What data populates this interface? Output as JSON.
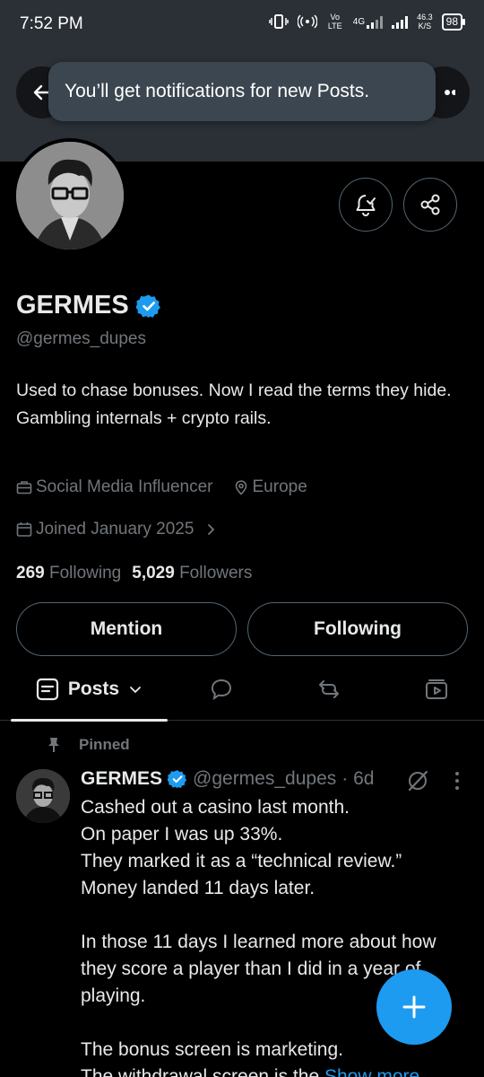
{
  "status_bar": {
    "time": "7:52 PM",
    "vo_lte": "Vo LTE",
    "network": "4G",
    "net_speed_value": "46.3",
    "net_speed_unit": "K/S",
    "battery": "98",
    "icons": [
      "vibrate-icon",
      "hotspot-icon",
      "signal-icon",
      "battery-icon"
    ]
  },
  "toast": {
    "text": "You’ll get notifications for new Posts."
  },
  "profile": {
    "name": "GERMES",
    "handle": "@germes_dupes",
    "bio_line1": "Used to chase bonuses. Now I read the terms they hide.",
    "bio_line2": "Gambling internals + crypto rails.",
    "category": "Social Media Influencer",
    "location": "Europe",
    "joined": "Joined January 2025",
    "following_count": "269",
    "following_label": "Following",
    "followers_count": "5,029",
    "followers_label": "Followers"
  },
  "buttons": {
    "mention": "Mention",
    "following": "Following"
  },
  "tabs": {
    "posts": "Posts"
  },
  "post": {
    "pinned_label": "Pinned",
    "author_name": "GERMES",
    "author_handle": "@germes_dupes",
    "age": "· 6d",
    "lines_a": [
      "Cashed out a casino last month.",
      "On paper I was up 33%.",
      "They marked it as a “technical review.”",
      "Money landed 11 days later."
    ],
    "para_b": "In those 11 days I learned more about how they score a player than I did in a year of playing.",
    "line_c": "The bonus screen is marketing.",
    "line_d": "The withdrawal screen is the",
    "show_more": "Show more"
  },
  "colors": {
    "accent": "#1d9bf0",
    "muted": "#71767b",
    "text": "#e7e9ea",
    "border": "#536471",
    "background": "#000000",
    "banner": "#2a3036"
  }
}
